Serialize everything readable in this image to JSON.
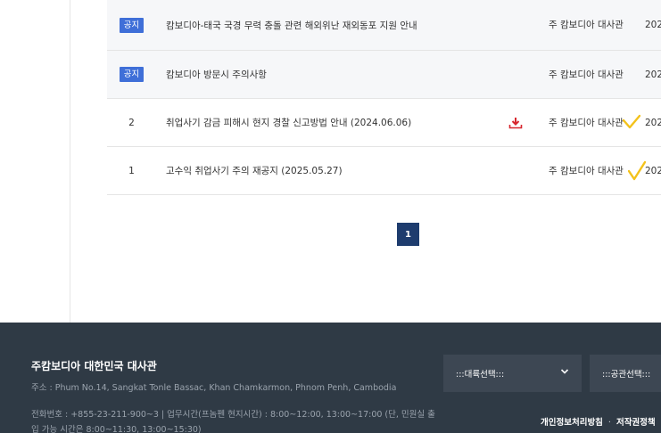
{
  "board": {
    "rows": [
      {
        "num": "공지",
        "notice": true,
        "title": "캄보디아-태국 국경 무력 충돌 관련 해외위난 재외동포 지원 안내",
        "attachment": false,
        "dept": "주 캄보디아 대사관",
        "date": "202"
      },
      {
        "num": "공지",
        "notice": true,
        "title": "캄보디아 방문시 주의사항",
        "attachment": false,
        "dept": "주 캄보디아 대사관",
        "date": "202"
      },
      {
        "num": "2",
        "notice": false,
        "title": "취업사기 감금 피해시 현지 경찰 신고방법 안내 (2024.06.06)",
        "attachment": true,
        "dept": "주 캄보디아 대사관",
        "date": "202"
      },
      {
        "num": "1",
        "notice": false,
        "title": "고수익 취업사기 주의 재공지 (2025.05.27)",
        "attachment": false,
        "dept": "주 캄보디아 대사관",
        "date": "202"
      }
    ]
  },
  "pagination": {
    "current": "1"
  },
  "footer": {
    "org_name": "주캄보디아 대한민국 대사관",
    "address": "주소 : Phum No.14, Sangkat Tonle Bassac, Khan Chamkarmon, Phnom Penh, Cambodia",
    "phone_hours": "전화번호 : +855-23-211-900~3 | 업무시간(프놈펜 현지시간) : 8:00~12:00, 13:00~17:00 (단, 민원실 출입 가능 시간은 8:00~11:30, 13:00~15:30)",
    "continent_select": ":::대륙선택:::",
    "mission_select": ":::공관선택:::",
    "privacy_link": "개인정보처리방침",
    "separator": "·",
    "copyright_link": "저작권정책"
  },
  "colors": {
    "notice_badge": "#3f6fd8",
    "pager_active": "#1e3c6e",
    "footer_bg": "#2f3a45",
    "download_icon": "#d7262e",
    "check_mark": "#f3c21b"
  }
}
